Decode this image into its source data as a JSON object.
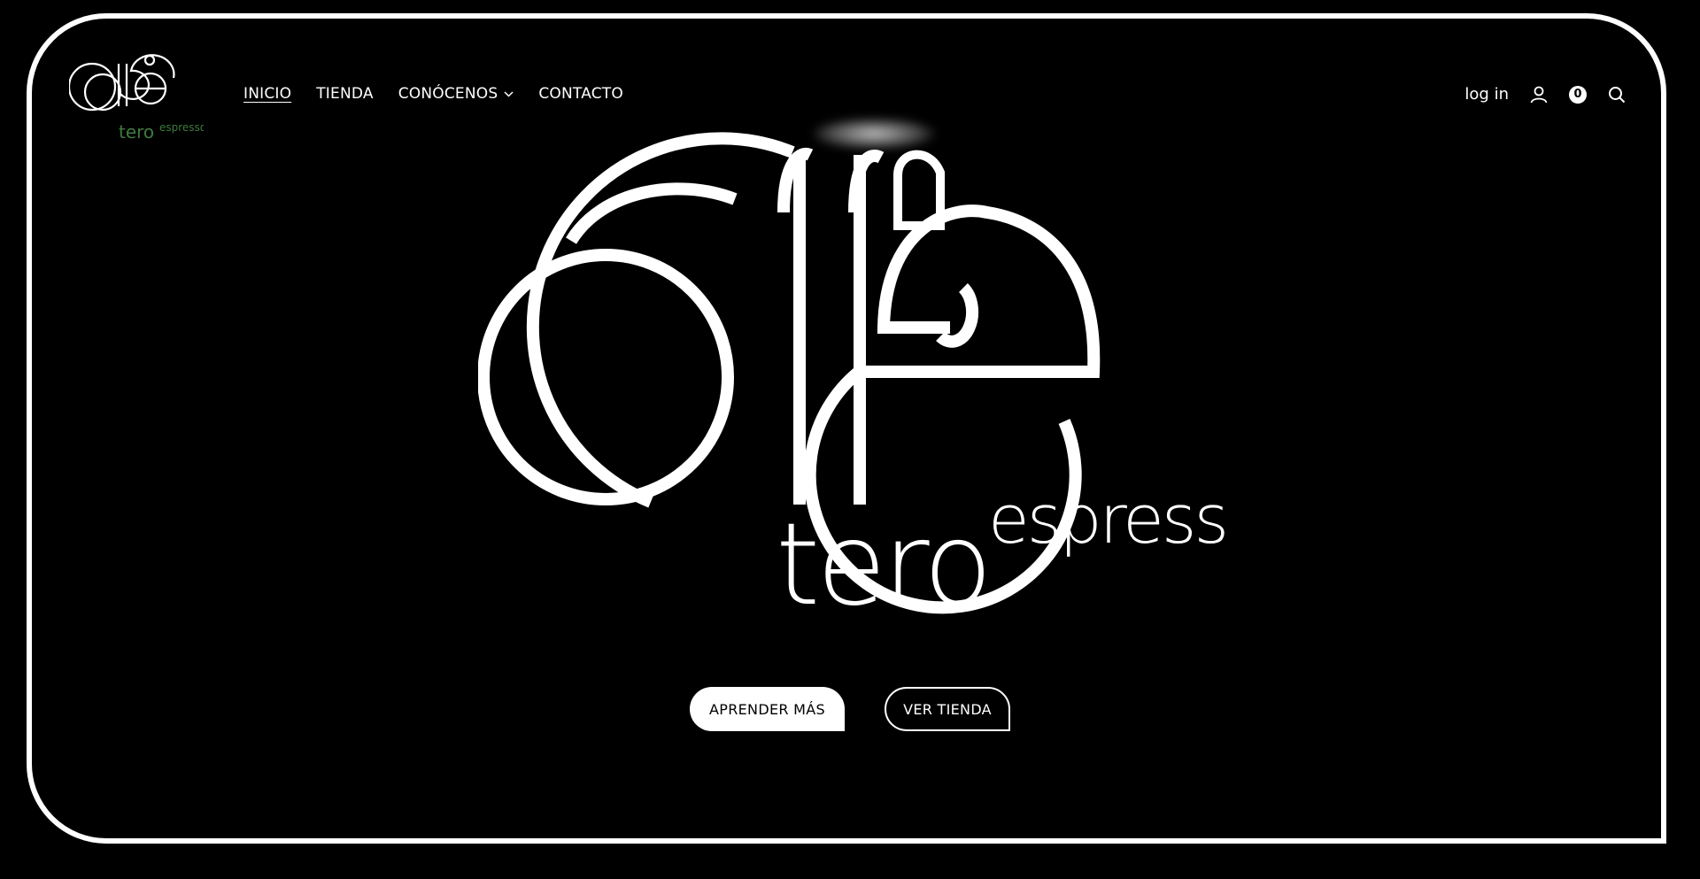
{
  "header": {
    "nav": [
      {
        "label": "INICIO",
        "active": true
      },
      {
        "label": "TIENDA"
      },
      {
        "label": "CONÓCENOS",
        "has_dropdown": true
      },
      {
        "label": "CONTACTO"
      }
    ],
    "login_label": "log in",
    "cart_count": "0",
    "icons": [
      "user-icon",
      "cart-count-badge",
      "search-icon",
      "chevron-down-icon"
    ]
  },
  "logo": {
    "word": "café",
    "sub1": "tero",
    "sub2": "espresso",
    "accent_color": "#3f7a3f"
  },
  "hero": {
    "primary_button": "APRENDER MÁS",
    "secondary_button": "VER TIENDA"
  },
  "colors": {
    "background": "#000000",
    "foreground": "#ffffff"
  }
}
